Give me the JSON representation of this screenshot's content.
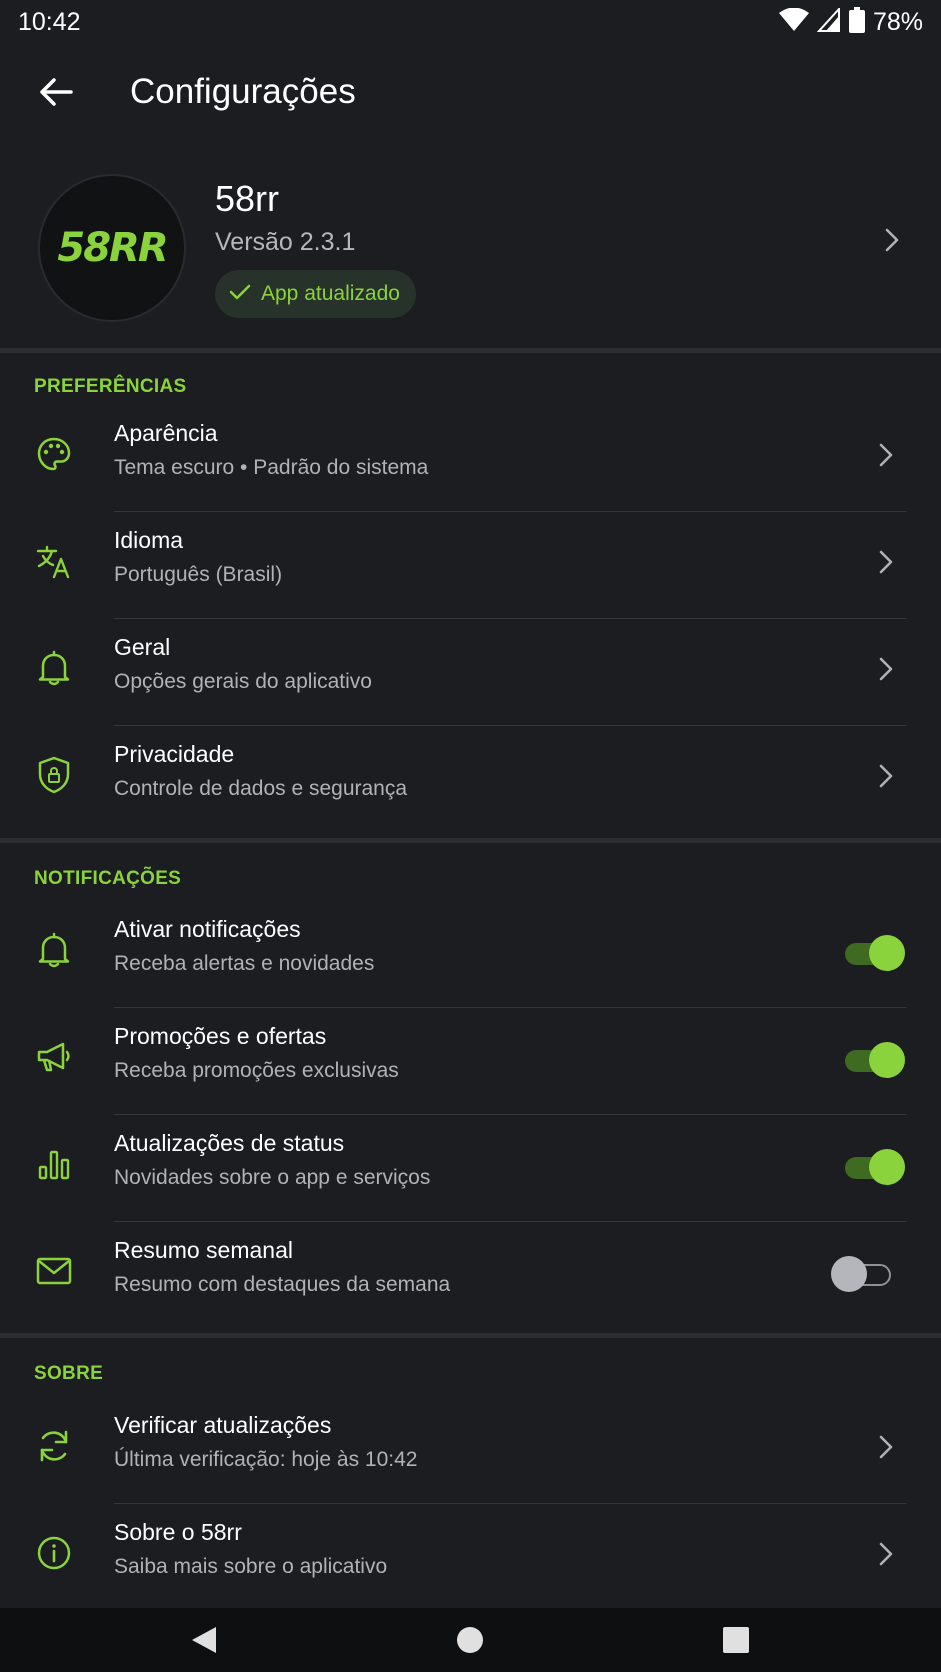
{
  "colors": {
    "accent": "#8bd33c",
    "background": "#1c1d21",
    "secondary_text": "#b0b2b8"
  },
  "status_bar": {
    "time": "10:42",
    "battery": "78%",
    "icons": [
      "wifi-icon",
      "signal-icon",
      "battery-icon"
    ]
  },
  "appbar": {
    "title": "Configurações",
    "back_icon": "arrow-back-icon"
  },
  "app_info": {
    "logo_text": "58RR",
    "name": "58rr",
    "version": "Versão 2.3.1",
    "status_chip": "App atualizado"
  },
  "sections": {
    "preferences": {
      "title": "PREFERÊNCIAS",
      "items": [
        {
          "icon": "palette-icon",
          "title": "Aparência",
          "subtitle": "Tema escuro • Padrão do sistema"
        },
        {
          "icon": "translate-icon",
          "title": "Idioma",
          "subtitle": "Português (Brasil)"
        },
        {
          "icon": "bell-icon",
          "title": "Geral",
          "subtitle": "Opções gerais do aplicativo"
        },
        {
          "icon": "shield-lock-icon",
          "title": "Privacidade",
          "subtitle": "Controle de dados e segurança"
        }
      ]
    },
    "notifications": {
      "title": "NOTIFICAÇÕES",
      "items": [
        {
          "icon": "bell-icon",
          "title": "Ativar notificações",
          "subtitle": "Receba alertas e novidades",
          "enabled": true
        },
        {
          "icon": "megaphone-icon",
          "title": "Promoções e ofertas",
          "subtitle": "Receba promoções exclusivas",
          "enabled": true
        },
        {
          "icon": "bar-chart-icon",
          "title": "Atualizações de status",
          "subtitle": "Novidades sobre o app e serviços",
          "enabled": true
        },
        {
          "icon": "mail-icon",
          "title": "Resumo semanal",
          "subtitle": "Resumo com destaques da semana",
          "enabled": false
        }
      ]
    },
    "about": {
      "title": "SOBRE",
      "items": [
        {
          "icon": "refresh-icon",
          "title": "Verificar atualizações",
          "subtitle": "Última verificação: hoje às 10:42"
        },
        {
          "icon": "info-icon",
          "title": "Sobre o 58rr",
          "subtitle": "Saiba mais sobre o aplicativo"
        }
      ]
    }
  },
  "nav_bar": {
    "icons": [
      "nav-back-icon",
      "nav-home-icon",
      "nav-recents-icon"
    ]
  }
}
